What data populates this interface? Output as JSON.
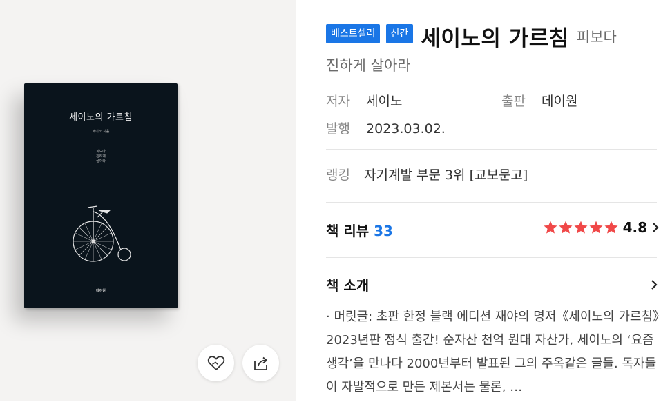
{
  "cover": {
    "title": "세이노의 가르침",
    "author": "세이노 지음",
    "subtitle": "피보다 진하게 살아라",
    "publisher": "데이원"
  },
  "actions": {
    "like_icon": "heart-icon",
    "share_icon": "share-icon"
  },
  "badges": {
    "bestseller": "베스트셀러",
    "new": "신간"
  },
  "book": {
    "title": "세이노의 가르침",
    "subtitle_part1": "피보다",
    "subtitle_part2": "진하게 살아라"
  },
  "meta": {
    "author_label": "저자",
    "author": "세이노",
    "publisher_label": "출판",
    "publisher": "데이원",
    "date_label": "발행",
    "date": "2023.03.02.",
    "ranking_label": "랭킹",
    "ranking": "자기계발 부문 3위 [교보문고]"
  },
  "reviews": {
    "label": "책 리뷰",
    "count": "33",
    "rating": "4.8",
    "stars": 5
  },
  "intro": {
    "label": "책 소개",
    "text": "· 머릿글: 초판 한정 블랙 에디션 재야의 명저《세이노의 가르침》2023년판 정식 출간! 순자산 천억 원대 자산가, 세이노의 ‘요즘 생각’을 만나다 2000년부터 발표된 그의 주옥같은 글들. 독자들이 자발적으로 만든 제본서는 물론, …"
  },
  "colors": {
    "accent": "#1a76e6",
    "star": "#f04848",
    "cover": "#0a141c"
  }
}
